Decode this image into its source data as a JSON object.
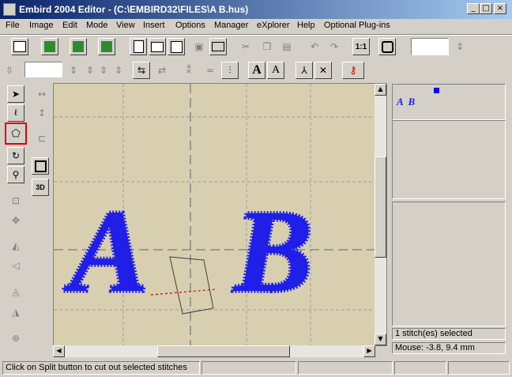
{
  "window": {
    "title": "Embird 2004 Editor - (C:\\EMBIRD32\\FILES\\A  B.hus)"
  },
  "menu": [
    "File",
    "Image",
    "Edit",
    "Mode",
    "View",
    "Insert",
    "Options",
    "Manager",
    "eXplorer",
    "Help",
    "Optional Plug-ins"
  ],
  "toolbar": {
    "zoom_ratio_label": "1:1",
    "value_field": ""
  },
  "preview": {
    "letters": "A  B"
  },
  "status": {
    "selection": "1 stitch(es) selected",
    "mouse": "Mouse: -3.8, 9.4 mm",
    "hint": "Click on Split button to cut out selected stitches"
  },
  "icons": [
    "program-icon",
    "minimize-icon",
    "maximize-icon",
    "close-icon",
    "hoop-icon",
    "new-icon",
    "open-icon",
    "save-icon",
    "print-icon",
    "cut-icon",
    "copy-icon",
    "paste-icon",
    "undo-icon",
    "redo-icon",
    "arrow-icon",
    "lasso-icon",
    "split-icon",
    "rotate-icon",
    "zoom-icon",
    "text-icon",
    "lock-icon",
    "3d-icon"
  ],
  "colors": {
    "accent": "#0a246a",
    "stitch": "#1f1fe8",
    "canvas": "#d8cfb0",
    "highlight": "#e00000"
  },
  "canvas": {
    "letter_a": "A",
    "letter_b": "B"
  }
}
